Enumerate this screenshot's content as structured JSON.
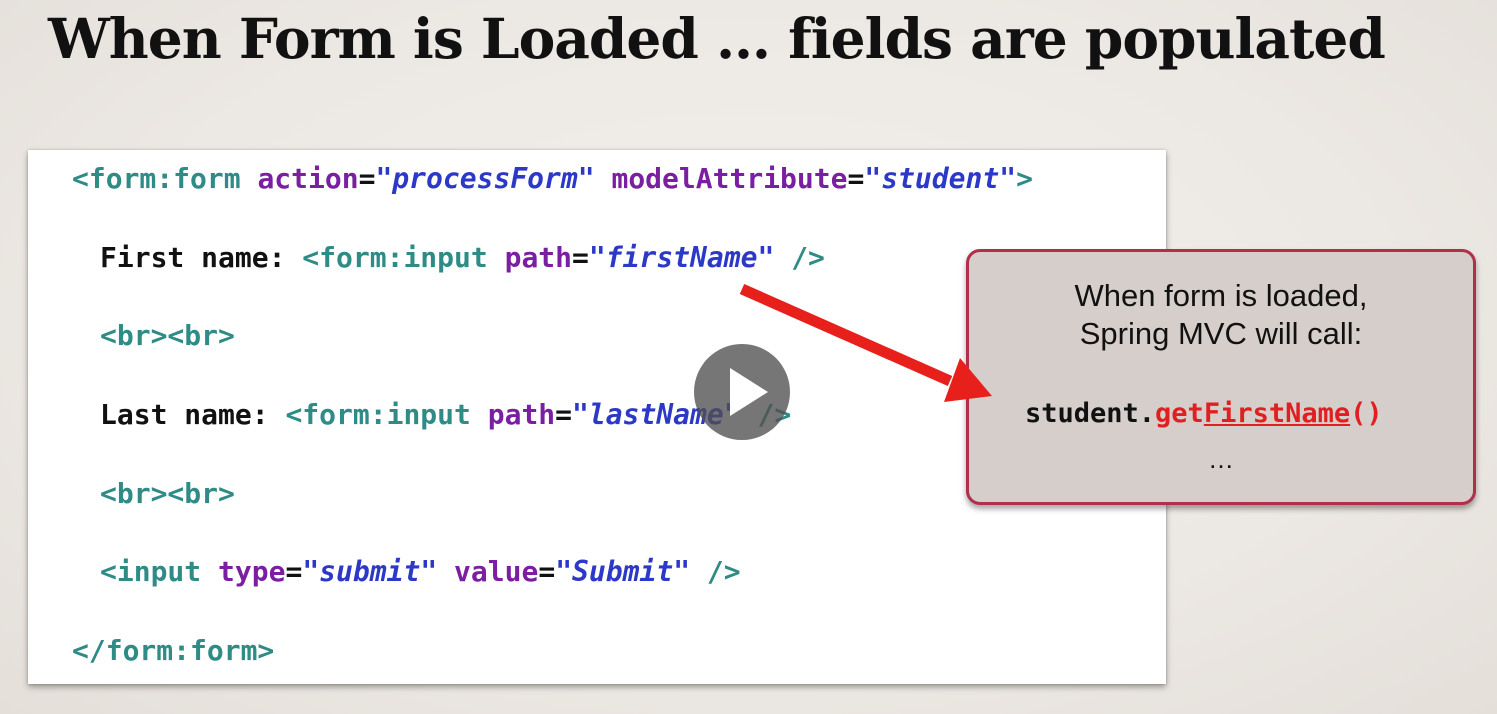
{
  "slide": {
    "title": "When Form is Loaded … fields are populated"
  },
  "code": {
    "line1": {
      "open": "<form:form",
      "attr1": "action",
      "eq1": "=",
      "val1": "\"processForm\"",
      "attr2": "modelAttribute",
      "eq2": "=",
      "val2": "\"student\"",
      "close": ">"
    },
    "line2": {
      "label": "First name: ",
      "open": "<form:input",
      "attr": "path",
      "eq": "=",
      "val": "\"firstName\"",
      "close": "/>"
    },
    "line3": {
      "tags": "<br><br>"
    },
    "line4": {
      "label": "Last name: ",
      "open": "<form:input",
      "attr": "path",
      "eq": "=",
      "val": "\"lastName\"",
      "close": "/>"
    },
    "line5": {
      "tags": "<br><br>"
    },
    "line6": {
      "open": "<input",
      "attr1": "type",
      "eq1": "=",
      "val1": "\"submit\"",
      "attr2": "value",
      "eq2": "=",
      "val2": "\"Submit\"",
      "close": "/>"
    },
    "line7": {
      "close": "</form:form>"
    }
  },
  "callout": {
    "line1": "When form is loaded,",
    "line2": "Spring MVC will call:",
    "call_object": "student.",
    "call_get": "get",
    "call_prop": "FirstName",
    "call_parens": "()",
    "ellipsis": "…"
  },
  "colors": {
    "tag": "#2e8b86",
    "attribute": "#7b1fa2",
    "string": "#2c38c7",
    "callout_border": "#b0304a",
    "arrow": "#e8201c"
  },
  "icons": {
    "play": "play-icon",
    "arrow": "arrow-icon"
  }
}
